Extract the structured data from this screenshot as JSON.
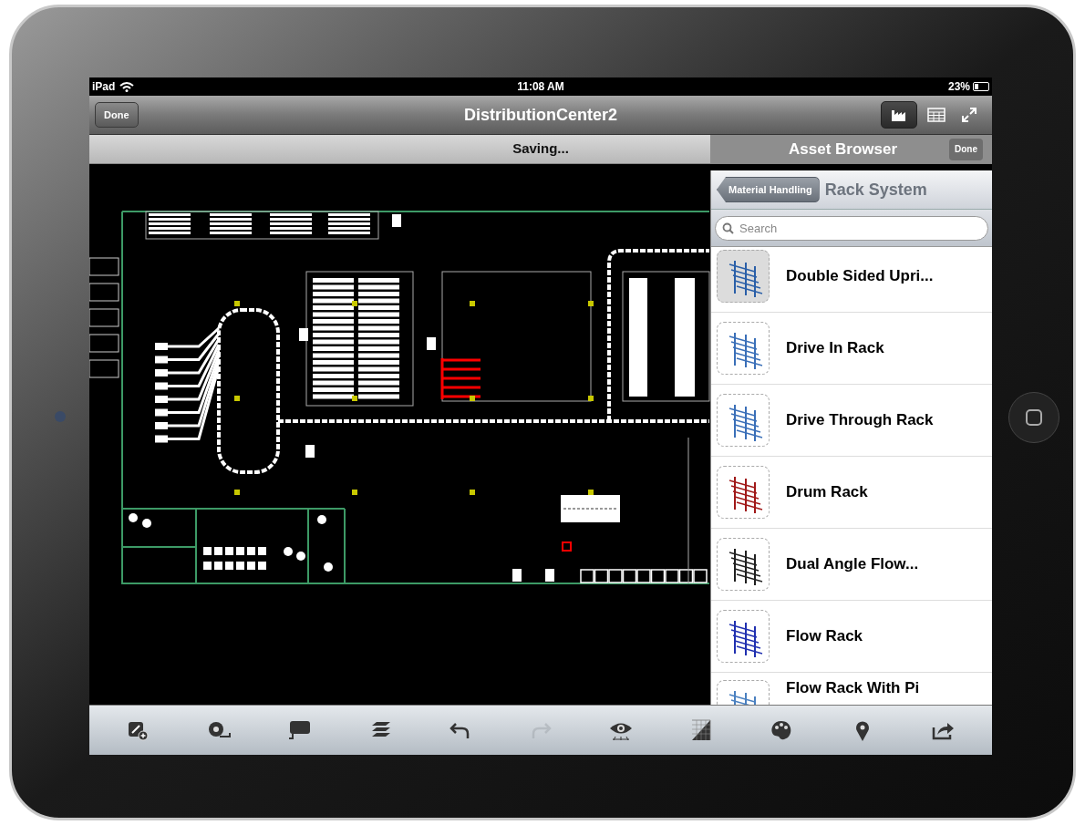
{
  "status_bar": {
    "device": "iPad",
    "time": "11:08 AM",
    "battery": "23%"
  },
  "nav_bar": {
    "done_button": "Done",
    "title": "DistributionCenter2",
    "tools": [
      {
        "kind": "factory",
        "selected": true
      },
      {
        "kind": "table",
        "selected": false
      },
      {
        "kind": "expand",
        "selected": false
      }
    ]
  },
  "saving_bar": {
    "text": "Saving..."
  },
  "asset_browser": {
    "title": "Asset Browser",
    "done_button": "Done",
    "back_button": "Material Handling",
    "heading": "Rack System",
    "search": {
      "placeholder": "Search"
    },
    "items": [
      {
        "label": "Double Sided Upri...",
        "selected": true,
        "color": "#2a5fa8"
      },
      {
        "label": "Drive In Rack",
        "selected": false,
        "color": "#3a6fb8"
      },
      {
        "label": "Drive Through Rack",
        "selected": false,
        "color": "#3a6fb8"
      },
      {
        "label": "Drum Rack",
        "selected": false,
        "color": "#a01818"
      },
      {
        "label": "Dual Angle Flow...",
        "selected": false,
        "color": "#202020"
      },
      {
        "label": "Flow Rack",
        "selected": false,
        "color": "#2030b0"
      },
      {
        "label": "Flow Rack With Pi",
        "selected": false,
        "color": "#4a80c0"
      }
    ]
  },
  "toolbar": {
    "buttons": [
      {
        "kind": "annotate",
        "disabled": false
      },
      {
        "kind": "measure",
        "disabled": false
      },
      {
        "kind": "comment",
        "disabled": false
      },
      {
        "kind": "layers",
        "disabled": false
      },
      {
        "kind": "undo",
        "disabled": false
      },
      {
        "kind": "redo",
        "disabled": true
      },
      {
        "kind": "view",
        "disabled": false
      },
      {
        "kind": "grid",
        "disabled": false
      },
      {
        "kind": "palette",
        "disabled": false
      },
      {
        "kind": "pin",
        "disabled": false
      },
      {
        "kind": "share",
        "disabled": false
      }
    ]
  }
}
